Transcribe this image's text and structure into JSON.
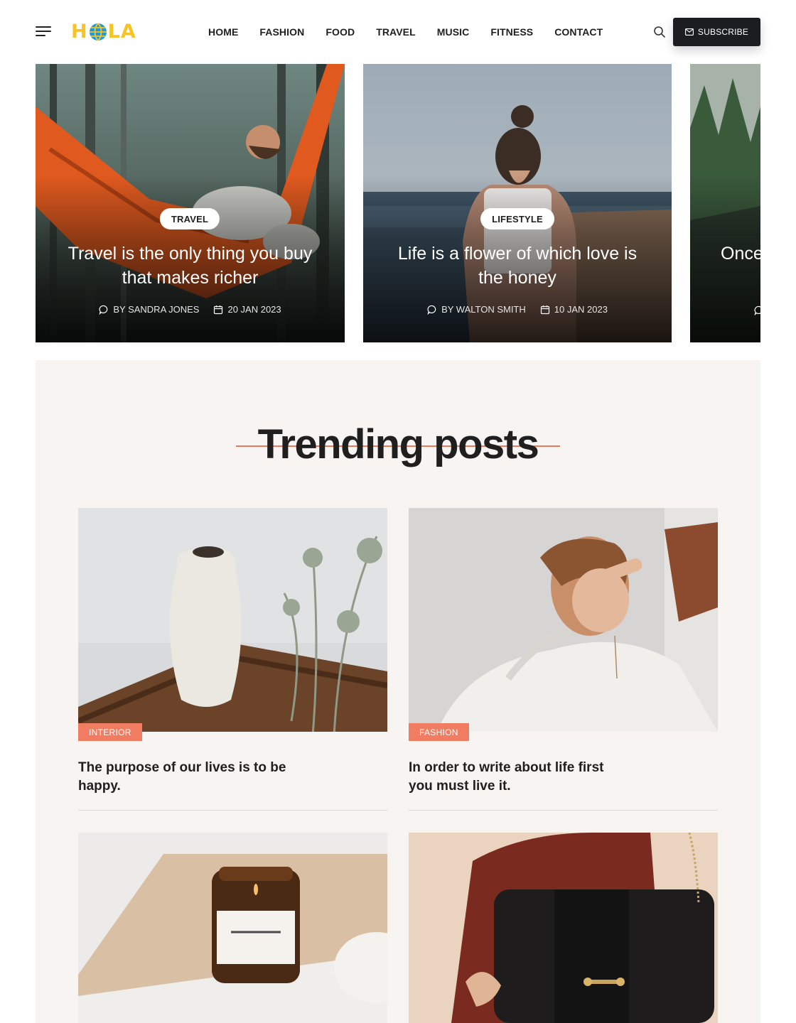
{
  "header": {
    "logo": {
      "letter1": "H",
      "letter2": "LA"
    },
    "nav": [
      "HOME",
      "FASHION",
      "FOOD",
      "TRAVEL",
      "MUSIC",
      "FITNESS",
      "CONTACT"
    ],
    "subscribe_label": "SUBSCRIBE",
    "icons": {
      "menu": "hamburger-icon",
      "search": "search-icon",
      "mail": "mail-icon"
    }
  },
  "slider": [
    {
      "tag": "TRAVEL",
      "title": "Travel is the only thing you buy that makes richer",
      "author": "BY SANDRA JONES",
      "date": "20 JAN 2023"
    },
    {
      "tag": "LIFESTYLE",
      "title": "Life is a flower of which love is the honey",
      "author": "BY WALTON SMITH",
      "date": "10 JAN 2023"
    },
    {
      "title_partial": "Once"
    }
  ],
  "trending": {
    "heading": "Trending posts",
    "posts": [
      {
        "category": "INTERIOR",
        "title": "The purpose of our lives is to be happy."
      },
      {
        "category": "FASHION",
        "title": "In order to write about life first you must live it."
      }
    ]
  },
  "colors": {
    "accent": "#f07c61",
    "logo": "#f7c325",
    "globe": "#1a9be0",
    "dark": "#1c1d20",
    "section_bg": "#f7f4f1"
  }
}
